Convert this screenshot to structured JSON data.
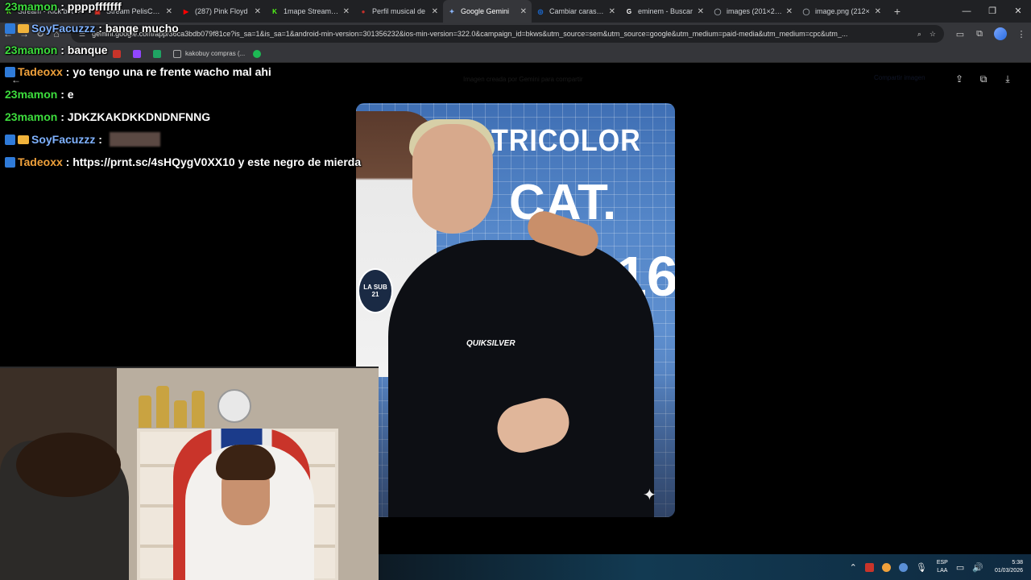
{
  "browser": {
    "tabs": [
      {
        "title": "Stream - Kick bet",
        "color": "#53fc18",
        "glyph": "K"
      },
      {
        "title": "Stream PelisChad",
        "color": "#d93025",
        "glyph": "▣"
      },
      {
        "title": "(287) Pink Floyd",
        "color": "#ff0000",
        "glyph": "▶"
      },
      {
        "title": "1mape Stream - K",
        "color": "#53fc18",
        "glyph": "K"
      },
      {
        "title": "Perfil musical de",
        "color": "#c4302b",
        "glyph": "●"
      },
      {
        "title": "Google Gemini",
        "color": "#8ab4f8",
        "glyph": "✦"
      },
      {
        "title": "Cambiar caras co",
        "color": "#1a73e8",
        "glyph": "◎"
      },
      {
        "title": "eminem - Buscar",
        "color": "#ffffff",
        "glyph": "G"
      },
      {
        "title": "images (201×251)",
        "color": "#9aa0a6",
        "glyph": "◯"
      },
      {
        "title": "image.png (212×",
        "color": "#9aa0a6",
        "glyph": "◯"
      }
    ],
    "active_tab": 5,
    "new_tab": "+",
    "window_controls": {
      "minimize": "—",
      "restore": "❐",
      "close": "✕"
    },
    "url": "gemini.google.com/app/36ca3bdb079f81ce?is_sa=1&is_sa=1&android-min-version=301356232&ios-min-version=322.0&campaign_id=bkws&utm_source=sem&utm_source=google&utm_medium=paid-media&utm_medium=cpc&utm_...",
    "bookmarks": [
      {
        "label": "kakobuy compras (...",
        "color": "#9aa0a6"
      }
    ]
  },
  "viewer": {
    "caption": "Imagen creada por Gemini para compartir",
    "ghost_button": "Compartir imagen"
  },
  "photo": {
    "banner_word": "TRICOLOR",
    "banner_cat": "CAT.",
    "banner_num": "16",
    "badge_text": "LA SUB 21",
    "shirt_logo": "QUIKSILVER"
  },
  "chat": [
    {
      "user": "23mamon",
      "color": "#3ddc3d",
      "badges": [],
      "text": ": ppppfffffff"
    },
    {
      "user": "SoyFacuzzz",
      "color": "#7fb2ff",
      "badges": [
        "b1",
        "b2"
      ],
      "text": ": banqe mucho"
    },
    {
      "user": "23mamon",
      "color": "#3ddc3d",
      "badges": [],
      "text": ": banque"
    },
    {
      "user": "Tadeoxx",
      "color": "#f0a13b",
      "badges": [
        "b1"
      ],
      "text": ": yo tengo una re frente wacho mal ahi"
    },
    {
      "user": "23mamon",
      "color": "#3ddc3d",
      "badges": [],
      "text": ": e"
    },
    {
      "user": "23mamon",
      "color": "#3ddc3d",
      "badges": [],
      "text": ": JDKZKAKDKKDNDNFNNG"
    },
    {
      "user": "SoyFacuzzz",
      "color": "#7fb2ff",
      "badges": [
        "b1",
        "b2"
      ],
      "text": ":"
    },
    {
      "user": "Tadeoxx",
      "color": "#f0a13b",
      "badges": [
        "b1"
      ],
      "text": ": https://prnt.sc/4sHQygV0XX10 y este negro de mierda"
    }
  ],
  "taskbar": {
    "lang_top": "ESP",
    "lang_bottom": "LAA",
    "time": "5:38",
    "date": "01/03/2026"
  }
}
